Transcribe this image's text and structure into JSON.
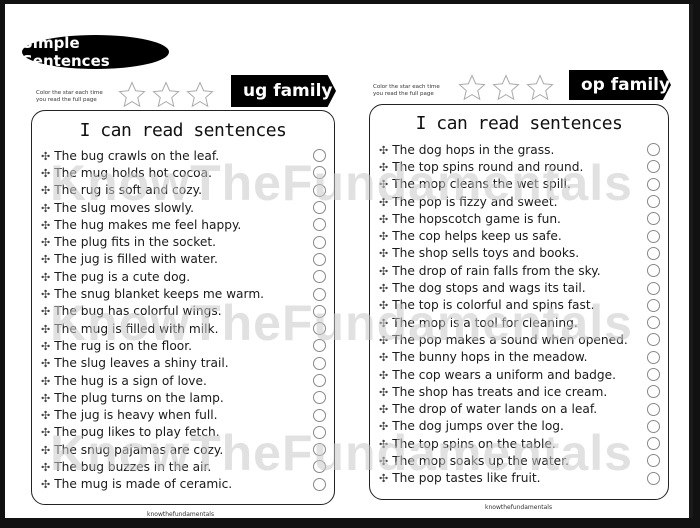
{
  "header": {
    "title": "Simple Sentences"
  },
  "instruction": {
    "line1": "Color the star each time",
    "line2": "you read the full page"
  },
  "watermark": "KnowTheFundamentals",
  "pages": [
    {
      "family_label": "ug family",
      "card_title": "I can read sentences",
      "bullet": "✣",
      "sentences": [
        "The bug crawls on the leaf.",
        "The mug holds hot cocoa.",
        "The rug is soft and cozy.",
        "The slug moves slowly.",
        "The hug makes me feel happy.",
        "The plug fits in the socket.",
        "The jug is filled with water.",
        "The pug is a cute dog.",
        "The snug blanket keeps me warm.",
        "The bug has colorful wings.",
        "The mug is filled with milk.",
        "The rug is on the floor.",
        "The slug leaves a shiny trail.",
        "The hug is a sign of love.",
        "The plug turns on the lamp.",
        "The jug is heavy when full.",
        "The pug likes to play fetch.",
        "The snug pajamas are cozy.",
        "The bug buzzes in the air.",
        "The mug is made of ceramic."
      ],
      "footer": "knowthefundamentals"
    },
    {
      "family_label": "op family",
      "card_title": "I can read sentences",
      "bullet": "✣",
      "sentences": [
        "The dog hops in the grass.",
        "The top spins round and round.",
        "The mop cleans the wet spill.",
        "The pop is fizzy and sweet.",
        "The hopscotch game is fun.",
        "The cop helps keep us safe.",
        "The shop sells toys and books.",
        "The drop of rain falls from the sky.",
        "The dog stops and wags its tail.",
        "The top is colorful and spins fast.",
        "The mop is a tool for cleaning.",
        "The pop makes a sound when opened.",
        "The bunny hops in the meadow.",
        "The cop wears a uniform and badge.",
        "The shop has treats and ice cream.",
        "The drop of water lands on a leaf.",
        "The dog jumps over the log.",
        "The top spins on the table.",
        "The mop soaks up the water.",
        "The pop tastes like fruit."
      ],
      "footer": "knowthefundamentals"
    }
  ]
}
